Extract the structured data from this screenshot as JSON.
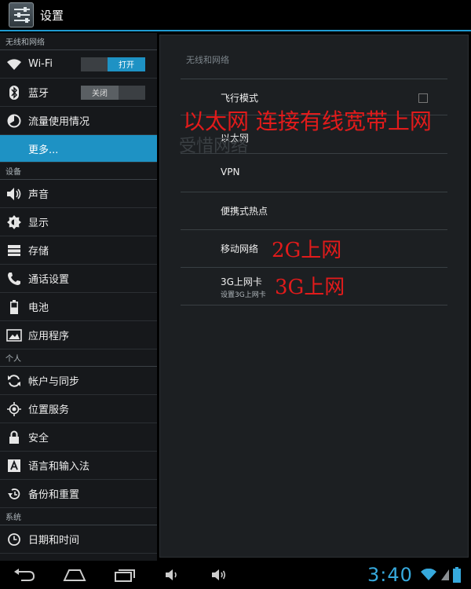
{
  "actionbar": {
    "title": "设置",
    "icon": "settings-sliders-icon"
  },
  "sidebar": {
    "sections": [
      {
        "header": "无线和网络"
      },
      {
        "header": "设备"
      },
      {
        "header": "个人"
      },
      {
        "header": "系统"
      }
    ],
    "items": [
      {
        "label": "Wi-Fi",
        "icon": "wifi-icon",
        "toggle": "打开"
      },
      {
        "label": "蓝牙",
        "icon": "bluetooth-icon",
        "toggle": "关闭"
      },
      {
        "label": "流量使用情况",
        "icon": "data-usage-icon"
      },
      {
        "label": "更多...",
        "selected": true
      },
      {
        "label": "声音",
        "icon": "speaker-icon"
      },
      {
        "label": "显示",
        "icon": "brightness-icon"
      },
      {
        "label": "存储",
        "icon": "storage-icon"
      },
      {
        "label": "通话设置",
        "icon": "phone-icon"
      },
      {
        "label": "电池",
        "icon": "battery-icon"
      },
      {
        "label": "应用程序",
        "icon": "apps-icon"
      },
      {
        "label": "帐户与同步",
        "icon": "sync-icon"
      },
      {
        "label": "位置服务",
        "icon": "location-icon"
      },
      {
        "label": "安全",
        "icon": "lock-icon"
      },
      {
        "label": "语言和输入法",
        "icon": "keyboard-icon"
      },
      {
        "label": "备份和重置",
        "icon": "backup-icon"
      },
      {
        "label": "日期和时间",
        "icon": "clock-icon"
      }
    ]
  },
  "main": {
    "section_title": "无线和网络",
    "prefs": [
      {
        "title": "飞行模式",
        "checkbox": false
      },
      {
        "title": "以太网"
      },
      {
        "title": "VPN"
      },
      {
        "title": "便携式热点"
      },
      {
        "title": "移动网络"
      },
      {
        "title": "3G上网卡",
        "summary": "设置3G上网卡"
      }
    ],
    "annotations": {
      "ethernet": "以太网 连接有线宽带上网",
      "mobile": "2G上网",
      "card": "3G上网",
      "ghost": "受惜网络"
    }
  },
  "statusbar": {
    "time": "3:40"
  },
  "colors": {
    "accent": "#1e92c4",
    "annotation": "#e11b1b",
    "clock": "#36a9dd"
  }
}
